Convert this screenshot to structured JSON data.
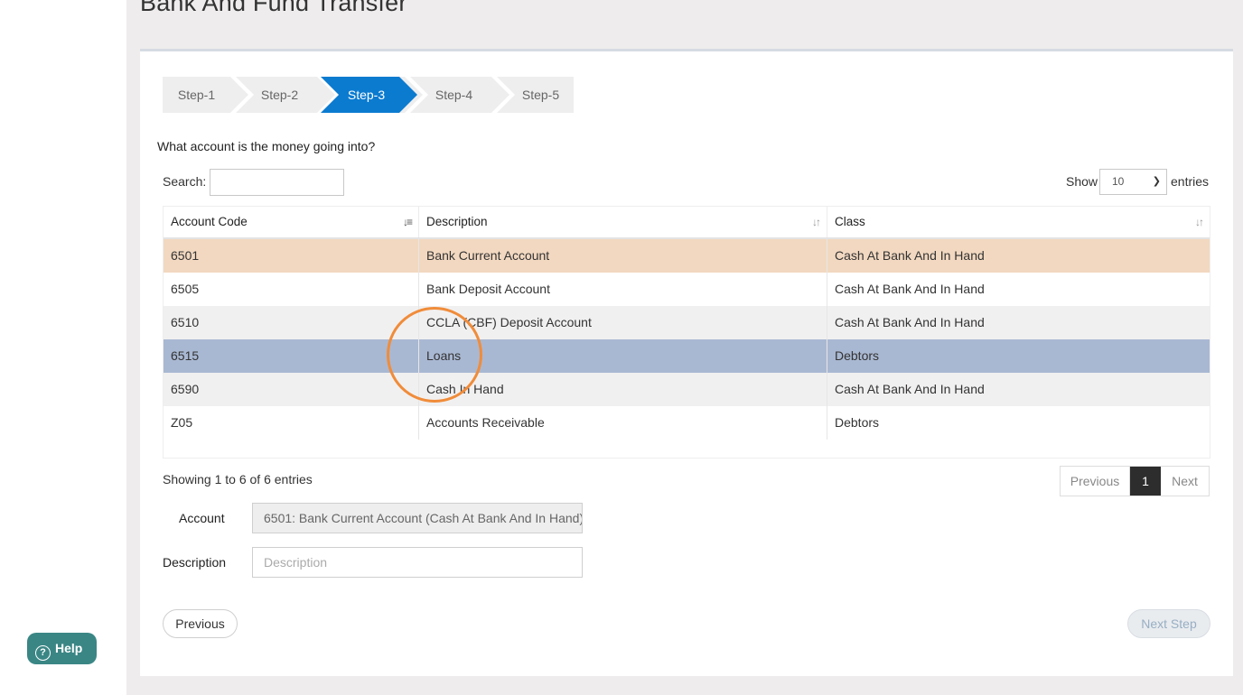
{
  "page": {
    "title": "Bank And Fund Transfer"
  },
  "wizard": {
    "steps": [
      {
        "label": "Step-1",
        "active": false
      },
      {
        "label": "Step-2",
        "active": false
      },
      {
        "label": "Step-3",
        "active": true
      },
      {
        "label": "Step-4",
        "active": false
      },
      {
        "label": "Step-5",
        "active": false
      }
    ],
    "active_color": "#0b7bd0"
  },
  "question": "What account is the money going into?",
  "table_controls": {
    "search_label": "Search:",
    "search_value": "",
    "show_label": "Show",
    "page_size": "10",
    "entries_label": "entries"
  },
  "table": {
    "headers": [
      "Account Code",
      "Description",
      "Class"
    ],
    "rows": [
      {
        "code": "6501",
        "description": "Bank Current Account",
        "class": "Cash At Bank And In Hand",
        "state": "selected"
      },
      {
        "code": "6505",
        "description": "Bank Deposit Account",
        "class": "Cash At Bank And In Hand",
        "state": "normal"
      },
      {
        "code": "6510",
        "description": "CCLA (CBF) Deposit Account",
        "class": "Cash At Bank And In Hand",
        "state": "striped"
      },
      {
        "code": "6515",
        "description": "Loans",
        "class": "Debtors",
        "state": "hover"
      },
      {
        "code": "6590",
        "description": "Cash In Hand",
        "class": "Cash At Bank And In Hand",
        "state": "striped"
      },
      {
        "code": "Z05",
        "description": "Accounts Receivable",
        "class": "Debtors",
        "state": "normal"
      }
    ],
    "row_colors": {
      "selected": "#f2d8c0",
      "hover": "#a9b8d2",
      "striped": "#f1f0f0",
      "normal": "#ffffff"
    }
  },
  "pagination": {
    "info": "Showing 1 to 6 of 6 entries",
    "previous": "Previous",
    "current_page": "1",
    "next": "Next"
  },
  "form": {
    "account_label": "Account",
    "account_value": "6501: Bank Current Account (Cash At Bank And In Hand)",
    "description_label": "Description",
    "description_placeholder": "Description"
  },
  "buttons": {
    "previous": "Previous",
    "next_step": "Next Step"
  },
  "help": {
    "label": "Help"
  },
  "colors": {
    "highlight_ring": "#f08c3a",
    "help_bg": "#3a8685"
  }
}
